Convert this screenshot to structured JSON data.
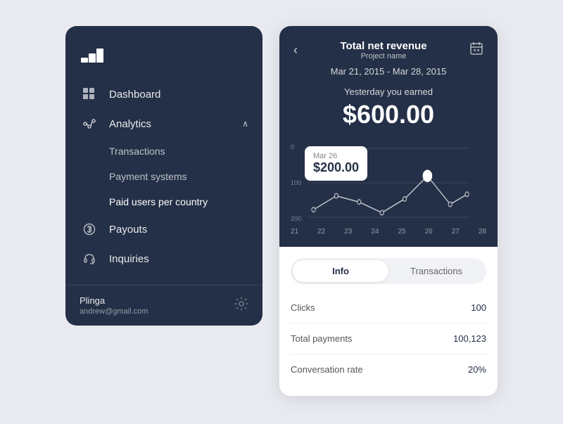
{
  "left_panel": {
    "logo": "stack-icon",
    "nav": [
      {
        "id": "dashboard",
        "label": "Dashboard",
        "icon": "grid-icon",
        "active": false,
        "has_children": false
      },
      {
        "id": "analytics",
        "label": "Analytics",
        "icon": "analytics-icon",
        "active": true,
        "has_children": true,
        "children": [
          {
            "id": "transactions",
            "label": "Transactions"
          },
          {
            "id": "payment-systems",
            "label": "Payment systems"
          },
          {
            "id": "paid-users",
            "label": "Paid users per country"
          }
        ]
      },
      {
        "id": "payouts",
        "label": "Payouts",
        "icon": "dollar-icon",
        "active": false
      },
      {
        "id": "inquiries",
        "label": "Inquiries",
        "icon": "headset-icon",
        "active": false
      }
    ],
    "user": {
      "name": "Plinga",
      "email": "andrew@gmail.com"
    }
  },
  "right_panel": {
    "header": {
      "title": "Total net revenue",
      "subtitle": "Project name",
      "date_range": "Mar 21, 2015 - Mar 28, 2015",
      "earned_label": "Yesterday you earned",
      "earned_amount": "$600.00"
    },
    "chart": {
      "y_labels": [
        "200",
        "100",
        "0"
      ],
      "x_labels": [
        "21",
        "22",
        "23",
        "24",
        "25",
        "26",
        "27",
        "28"
      ],
      "tooltip": {
        "date": "Mar 26",
        "amount": "$200.00"
      },
      "data_points": [
        30,
        55,
        40,
        20,
        45,
        80,
        30,
        50
      ]
    },
    "tabs": [
      {
        "id": "info",
        "label": "Info",
        "active": true
      },
      {
        "id": "transactions",
        "label": "Transactions",
        "active": false
      }
    ],
    "stats": [
      {
        "label": "Clicks",
        "value": "100"
      },
      {
        "label": "Total payments",
        "value": "100,123"
      },
      {
        "label": "Conversation rate",
        "value": "20%"
      }
    ]
  }
}
